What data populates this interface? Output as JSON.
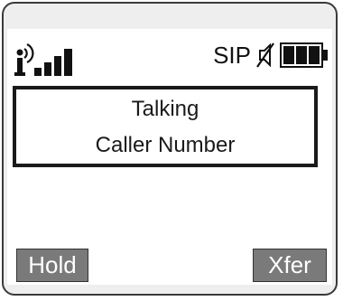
{
  "status_bar": {
    "network_label": "SIP",
    "icons": [
      "signal-strength-icon",
      "mute-icon",
      "battery-icon"
    ]
  },
  "call": {
    "status": "Talking",
    "caller": "Caller Number"
  },
  "softkeys": {
    "left": "Hold",
    "right": "Xfer"
  },
  "colors": {
    "screen_bg": "#ffffff",
    "softkey_bg": "#7a7a7a",
    "softkey_text": "#ffffff",
    "text": "#1a1a1a",
    "frame": "#eeeeee"
  }
}
